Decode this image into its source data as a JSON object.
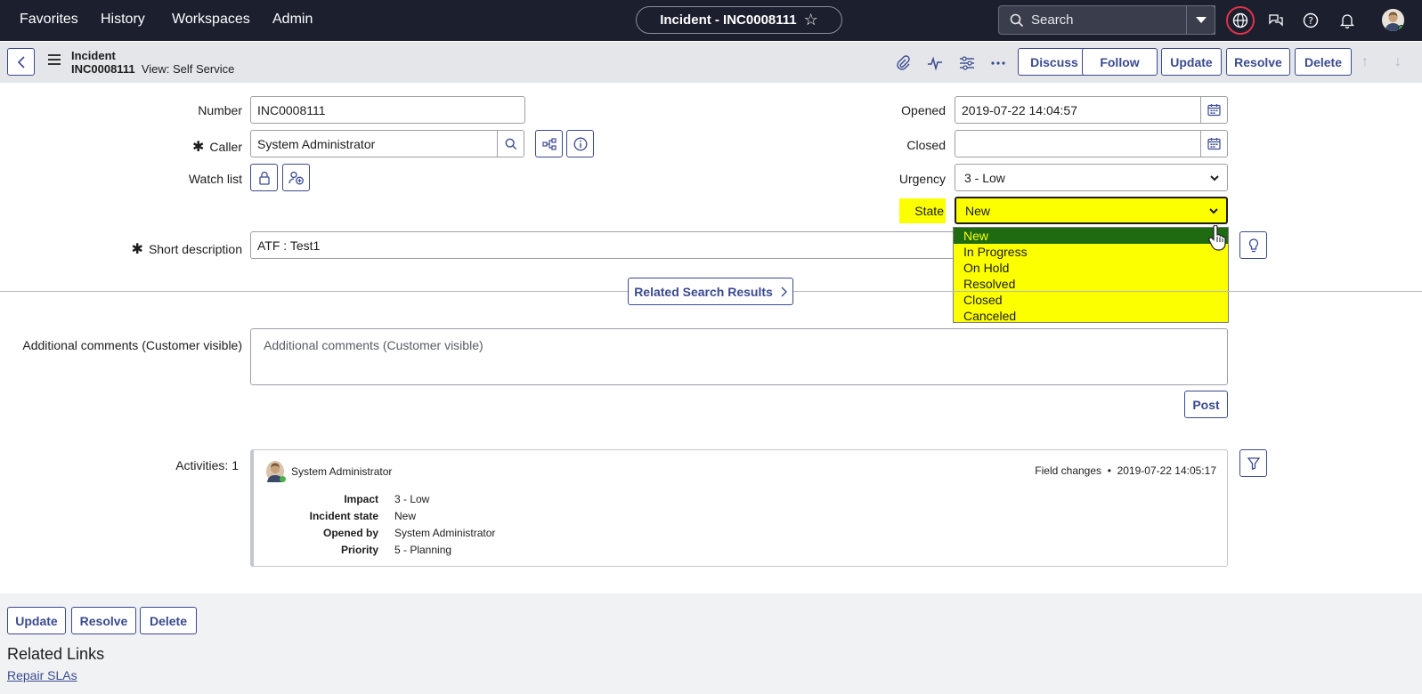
{
  "topnav": {
    "menu": [
      "Favorites",
      "History",
      "Workspaces",
      "Admin"
    ],
    "record_title": "Incident - INC0008111",
    "search_placeholder": "Search"
  },
  "header": {
    "table_name": "Incident",
    "record_number": "INC0008111",
    "view_label": "View: Self Service",
    "buttons": {
      "discuss": "Discuss",
      "follow": "Follow",
      "update": "Update",
      "resolve": "Resolve",
      "delete": "Delete"
    }
  },
  "form": {
    "number": {
      "label": "Number",
      "value": "INC0008111"
    },
    "caller": {
      "label": "Caller",
      "value": "System Administrator"
    },
    "watch_list": {
      "label": "Watch list"
    },
    "opened": {
      "label": "Opened",
      "value": "2019-07-22 14:04:57"
    },
    "closed": {
      "label": "Closed",
      "value": ""
    },
    "urgency": {
      "label": "Urgency",
      "value": "3 - Low"
    },
    "state": {
      "label": "State",
      "value": "New",
      "options": [
        "New",
        "In Progress",
        "On Hold",
        "Resolved",
        "Closed",
        "Canceled"
      ]
    },
    "short_description": {
      "label": "Short description",
      "value": "ATF : Test1"
    },
    "related_search": "Related Search Results",
    "additional_comments": {
      "label": "Additional comments (Customer visible)",
      "placeholder": "Additional comments (Customer visible)"
    },
    "post_button": "Post",
    "activities_label": "Activities: 1"
  },
  "activity": {
    "user": "System Administrator",
    "type": "Field changes",
    "timestamp": "2019-07-22 14:05:17",
    "separator": "•",
    "changes": [
      {
        "field": "Impact",
        "value": "3 - Low"
      },
      {
        "field": "Incident state",
        "value": "New"
      },
      {
        "field": "Opened by",
        "value": "System Administrator"
      },
      {
        "field": "Priority",
        "value": "5 - Planning"
      }
    ]
  },
  "footer": {
    "buttons": {
      "update": "Update",
      "resolve": "Resolve",
      "delete": "Delete"
    },
    "related_links_title": "Related Links",
    "links": [
      "Repair SLAs"
    ]
  },
  "colors": {
    "nav_bg": "#1c1f2e",
    "accent": "#3a4a8f",
    "highlight": "#fbff00",
    "selected_option_bg": "#1f6b12",
    "alert_ring": "#e2324a"
  }
}
